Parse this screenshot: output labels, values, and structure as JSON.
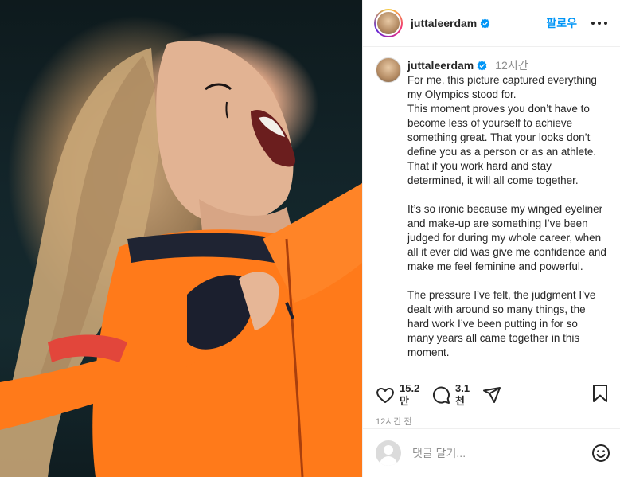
{
  "post": {
    "username": "juttaleerdam",
    "follow_label": "팔로우",
    "caption_time": "12시간",
    "caption": "For me, this picture captured everything my Olympics stood for.\nThis moment proves you don’t have to become less of yourself to achieve something great. That your looks don’t define you as a person or as an athlete. That if you work hard and stay determined, it will all come together.\n\nIt’s so ironic because my winged eyeliner and make-up are something I’ve been judged for during my whole career, when all it ever did was give me confidence and make me feel feminine and powerful.\n\nThe pressure I’ve felt, the judgment I’ve dealt with around so many things, the hard work I’ve been putting in for so many years all came together in this moment."
  },
  "actions": {
    "likes_line1": "15.2",
    "likes_line2": "만",
    "comments_line1": "3.1",
    "comments_line2": "천",
    "time_ago": "12시간 전"
  },
  "comment_box": {
    "placeholder": "댓글 달기..."
  },
  "icons": {
    "verified": "verified-badge-icon",
    "more": "more-horizontal-icon",
    "like": "heart-icon",
    "comment": "comment-bubble-icon",
    "share": "share-paper-plane-icon",
    "save": "bookmark-icon",
    "emoji": "smiley-icon"
  },
  "colors": {
    "accent": "#0095f6",
    "verified": "#0095f6",
    "suit_orange": "#ff7a1a"
  }
}
